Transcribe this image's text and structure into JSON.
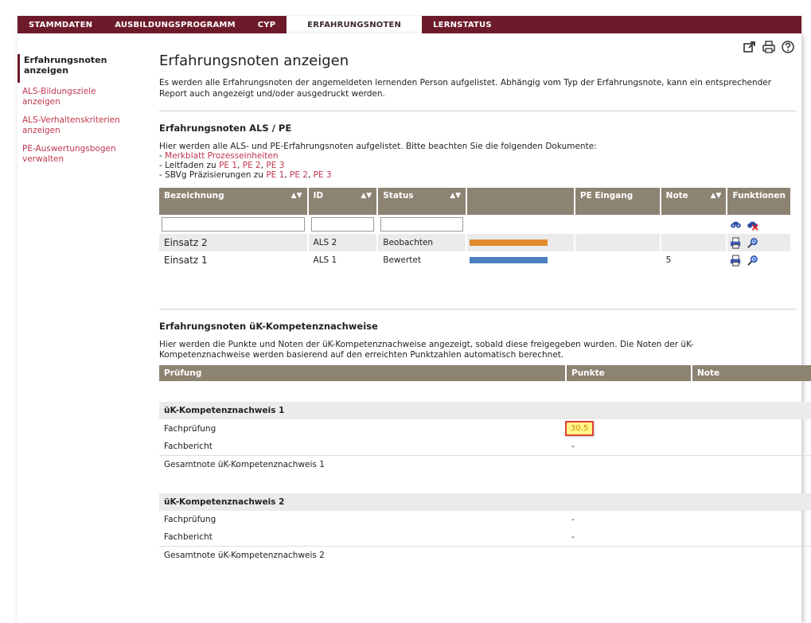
{
  "topnav": {
    "tabs": [
      "STAMMDATEN",
      "AUSBILDUNGSPROGRAMM",
      "CYP",
      "ERFAHRUNGSNOTEN",
      "LERNSTATUS"
    ],
    "active_index": 3
  },
  "sidebar": {
    "items": [
      {
        "label": "Erfahrungsnoten anzeigen",
        "active": true
      },
      {
        "label": "ALS-Bildungsziele anzeigen",
        "active": false
      },
      {
        "label": "ALS-Verhaltenskriterien anzeigen",
        "active": false
      },
      {
        "label": "PE-Auswertungsbogen verwalten",
        "active": false
      }
    ]
  },
  "page": {
    "title": "Erfahrungsnoten anzeigen",
    "intro": "Es werden alle Erfahrungsnoten der angemeldeten lernenden Person aufgelistet. Abhängig vom Typ der Erfahrungsnote, kann ein entsprechender Report auch angezeigt und/oder ausgedruckt werden."
  },
  "icons": {
    "top": [
      "external-link-icon",
      "print-icon",
      "help-icon"
    ]
  },
  "als": {
    "title": "Erfahrungsnoten ALS / PE",
    "text": "Hier werden alle ALS- und PE-Erfahrungsnoten aufgelistet. Bitte beachten Sie die folgenden Dokumente:",
    "doc_merkblatt": "Merkblatt Prozesseinheiten",
    "leitfaden_prefix": "Leitfaden zu",
    "sbvg_prefix": "SBVg Präzisierungen zu",
    "pe_links": [
      "PE 1",
      "PE 2",
      "PE 3"
    ],
    "headers": {
      "bezeichnung": "Bezeichnung",
      "id": "ID",
      "status": "Status",
      "pe_eingang": "PE Eingang",
      "note": "Note",
      "funktionen": "Funktionen"
    },
    "rows": [
      {
        "bezeichnung": "Einsatz 2",
        "id": "ALS 2",
        "status": "Beobachten",
        "bar_color": "#e08b2e",
        "pe_eingang": "",
        "note": ""
      },
      {
        "bezeichnung": "Einsatz 1",
        "id": "ALS 1",
        "status": "Bewertet",
        "bar_color": "#4a7fc1",
        "pe_eingang": "",
        "note": "5"
      }
    ]
  },
  "uk": {
    "title": "Erfahrungsnoten üK-Kompetenznachweise",
    "text": "Hier werden die Punkte und Noten der üK-Kompetenznachweise angezeigt, sobald diese freigegeben wurden. Die Noten der üK-Kompetenznachweise werden basierend auf den erreichten Punktzahlen automatisch berechnet.",
    "headers": {
      "pruefung": "Prüfung",
      "punkte": "Punkte",
      "note": "Note"
    },
    "groups": [
      {
        "name": "üK-Kompetenznachweis 1",
        "rows": [
          {
            "label": "Fachprüfung",
            "punkte": "30.5",
            "note": ""
          },
          {
            "label": "Fachbericht",
            "punkte": "-",
            "note": ""
          }
        ],
        "total_label": "Gesamtnote üK-Kompetenznachweis 1",
        "total_note": "-"
      },
      {
        "name": "üK-Kompetenznachweis 2",
        "rows": [
          {
            "label": "Fachprüfung",
            "punkte": "-",
            "note": ""
          },
          {
            "label": "Fachbericht",
            "punkte": "-",
            "note": ""
          }
        ],
        "total_label": "Gesamtnote üK-Kompetenznachweis 2",
        "total_note": "-"
      }
    ]
  }
}
